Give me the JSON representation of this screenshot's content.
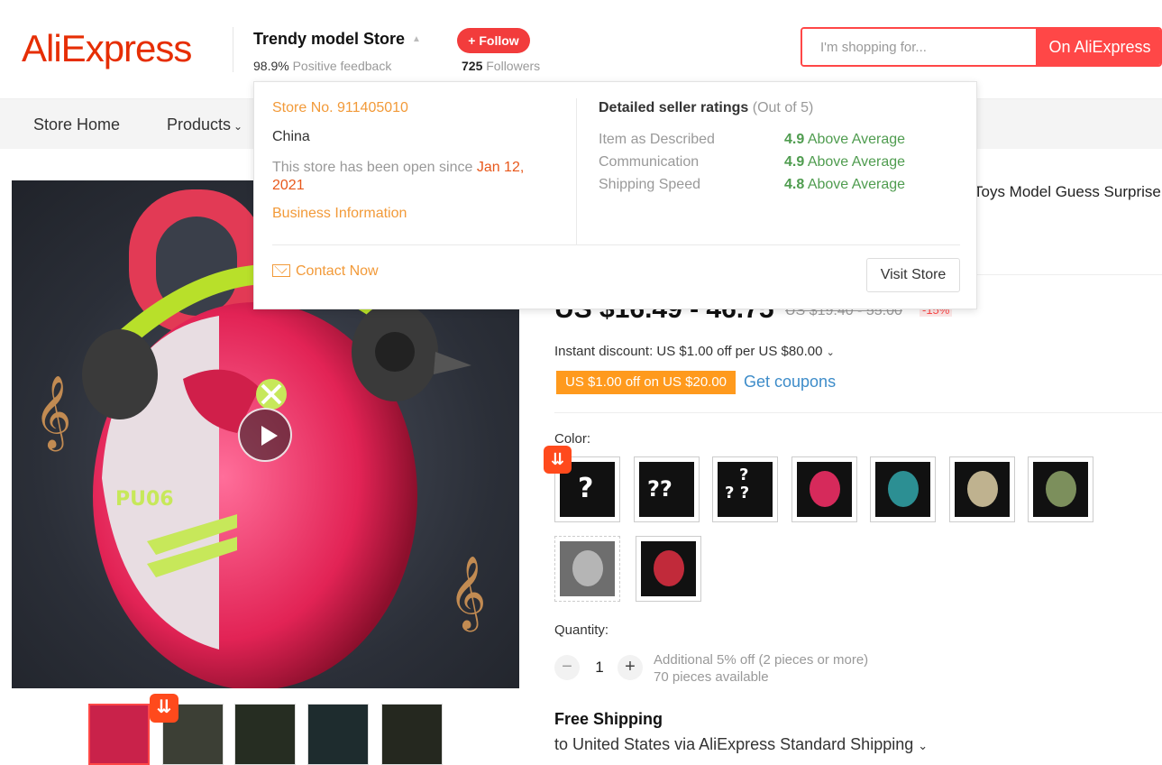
{
  "header": {
    "logo": "AliExpress",
    "store_name": "Trendy model Store",
    "feedback_pct": "98.9%",
    "feedback_label": "Positive feedback",
    "follow_label": "+ Follow",
    "followers_count": "725",
    "followers_label": "Followers",
    "search_placeholder": "I'm shopping for...",
    "search_button": "On AliExpress"
  },
  "nav": {
    "store_home": "Store Home",
    "products": "Products"
  },
  "popup": {
    "store_no": "Store No. 911405010",
    "country": "China",
    "open_since_text": "This store has been open since",
    "open_since_date": "Jan 12, 2021",
    "business_info": "Business Information",
    "ratings_title": "Detailed seller ratings",
    "ratings_scale": "(Out of 5)",
    "ratings": [
      {
        "label": "Item as Described",
        "score": "4.9",
        "verdict": "Above Average"
      },
      {
        "label": "Communication",
        "score": "4.9",
        "verdict": "Above Average"
      },
      {
        "label": "Shipping Speed",
        "score": "4.8",
        "verdict": "Above Average"
      }
    ],
    "contact_now": "Contact Now",
    "visit_store": "Visit Store"
  },
  "product": {
    "title_fragment": "Toys Model Guess Surprise",
    "price": "US $16.49 - 46.75",
    "old_price": "US $19.40 - 55.00",
    "discount": "-15%",
    "instant_discount": "Instant discount: US $1.00 off per US $80.00",
    "coupon": "US $1.00 off on US $20.00",
    "get_coupons": "Get coupons",
    "color_label": "Color:",
    "quantity_label": "Quantity:",
    "quantity_value": "1",
    "qty_note_1": "Additional 5% off (2 pieces or more)",
    "qty_note_2": "70 pieces available",
    "shipping_title": "Free Shipping",
    "shipping_sub": "to United States via AliExpress Standard Shipping"
  },
  "colors": {
    "brand_red": "#e62e04",
    "follow_red": "#f23c3c",
    "popup_orange": "#f29a39",
    "rating_green": "#4f9c4f",
    "coupon_orange": "#ff9a1d",
    "link_blue": "#3d8cc9"
  }
}
